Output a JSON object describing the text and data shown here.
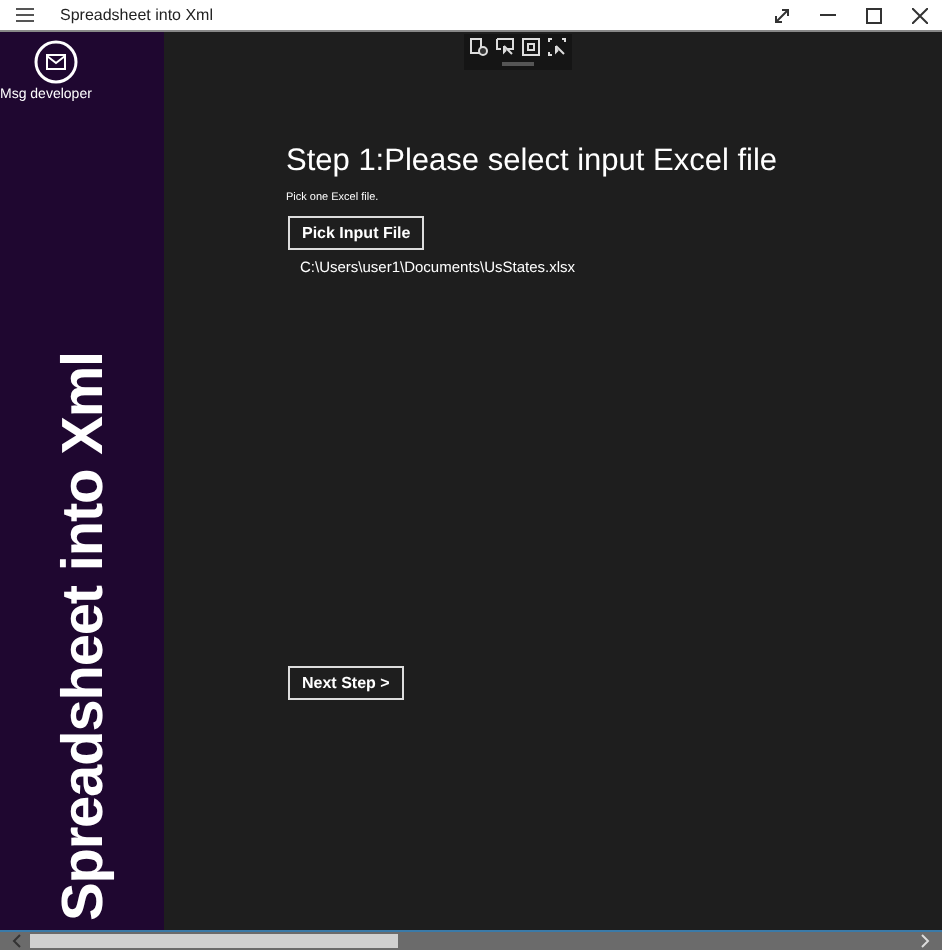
{
  "window": {
    "title": "Spreadsheet into Xml"
  },
  "sidebar": {
    "action": {
      "label": "Msg developer"
    },
    "banner": "Spreadsheet into Xml"
  },
  "step": {
    "heading": "Step 1:Please select input Excel file",
    "hint": "Pick one Excel file.",
    "pick_button": "Pick Input File",
    "file_path": "C:\\Users\\user1\\Documents\\UsStates.xlsx"
  },
  "next_button": "Next Step >"
}
